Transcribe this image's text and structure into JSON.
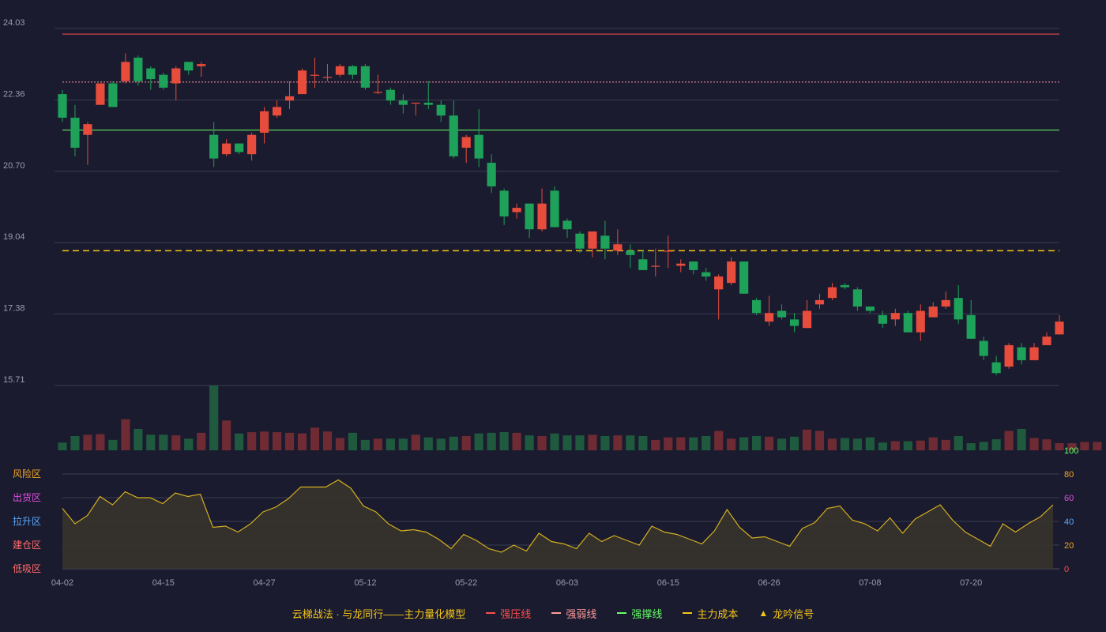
{
  "colors": {
    "background": "#1a1b2e",
    "up": "#e74c3c",
    "down": "#1ea25a",
    "grid": "#3a3c50",
    "axis_text": "#9a9cb0",
    "pressure_line": "#ff4d4d",
    "weak_line": "#ff9a9a",
    "support_line": "#66ff66",
    "cost_line": "#f5c518",
    "signal": "#f5c518",
    "osc_line": "#d4b020"
  },
  "legend": {
    "model": "云梯战法 · 与龙同行——主力量化模型",
    "pressure": "强压线",
    "weak": "强弱线",
    "support": "强撑线",
    "cost": "主力成本",
    "signal": "龙吟信号"
  },
  "chart_data": {
    "type": "candlestick",
    "y_ticks": [
      "15.71",
      "17.38",
      "19.04",
      "20.70",
      "22.36",
      "24.03"
    ],
    "ylim": [
      15.71,
      24.03
    ],
    "x_ticks": [
      "04-02",
      "04-15",
      "04-27",
      "05-12",
      "05-22",
      "06-03",
      "06-15",
      "06-26",
      "07-08",
      "07-20"
    ],
    "x_tick_index": [
      0,
      8,
      16,
      24,
      32,
      40,
      48,
      56,
      64,
      72
    ],
    "reference_lines": {
      "pressure": 23.9,
      "weak": 22.78,
      "support": 21.66,
      "cost": 18.85
    },
    "candles": [
      [
        22.5,
        21.95,
        22.6,
        21.85
      ],
      [
        21.95,
        21.25,
        22.25,
        21.05
      ],
      [
        21.55,
        21.8,
        21.85,
        20.85
      ],
      [
        22.25,
        22.75,
        22.75,
        22.25
      ],
      [
        22.75,
        22.2,
        22.8,
        22.2
      ],
      [
        22.8,
        23.25,
        23.45,
        22.75
      ],
      [
        23.35,
        22.8,
        23.4,
        22.7
      ],
      [
        23.1,
        22.85,
        23.15,
        22.6
      ],
      [
        22.95,
        22.65,
        23.0,
        22.6
      ],
      [
        22.75,
        23.1,
        23.15,
        22.35
      ],
      [
        23.25,
        23.05,
        23.25,
        22.95
      ],
      [
        23.15,
        23.2,
        23.25,
        22.9
      ],
      [
        21.55,
        21.0,
        21.85,
        20.8
      ],
      [
        21.1,
        21.35,
        21.45,
        21.05
      ],
      [
        21.35,
        21.15,
        21.35,
        21.1
      ],
      [
        21.1,
        21.55,
        21.6,
        20.95
      ],
      [
        21.6,
        22.1,
        22.2,
        21.35
      ],
      [
        22.0,
        22.2,
        22.35,
        21.95
      ],
      [
        22.35,
        22.45,
        22.8,
        22.15
      ],
      [
        22.5,
        23.05,
        23.1,
        22.5
      ],
      [
        22.95,
        22.95,
        23.35,
        22.65
      ],
      [
        22.9,
        22.9,
        23.2,
        22.8
      ],
      [
        22.95,
        23.15,
        23.2,
        22.9
      ],
      [
        23.15,
        22.95,
        23.18,
        22.85
      ],
      [
        23.15,
        22.65,
        23.2,
        22.6
      ],
      [
        22.55,
        22.55,
        22.95,
        22.5
      ],
      [
        22.6,
        22.35,
        22.65,
        22.25
      ],
      [
        22.35,
        22.25,
        22.5,
        22.05
      ],
      [
        22.3,
        22.3,
        22.3,
        22.0
      ],
      [
        22.3,
        22.25,
        22.8,
        22.15
      ],
      [
        22.25,
        22.0,
        22.35,
        21.85
      ],
      [
        22.0,
        21.05,
        22.35,
        21.0
      ],
      [
        21.25,
        21.5,
        21.55,
        20.9
      ],
      [
        21.55,
        21.0,
        22.15,
        20.8
      ],
      [
        20.9,
        20.35,
        21.1,
        20.2
      ],
      [
        20.25,
        19.65,
        20.3,
        19.45
      ],
      [
        19.75,
        19.85,
        19.95,
        19.6
      ],
      [
        19.95,
        19.35,
        19.95,
        19.15
      ],
      [
        19.35,
        19.95,
        20.3,
        19.3
      ],
      [
        20.25,
        19.4,
        20.35,
        19.4
      ],
      [
        19.55,
        19.35,
        19.6,
        19.15
      ],
      [
        19.25,
        18.9,
        19.3,
        18.8
      ],
      [
        18.9,
        19.3,
        19.3,
        18.7
      ],
      [
        19.2,
        18.9,
        19.55,
        18.65
      ],
      [
        18.85,
        19.0,
        19.35,
        18.75
      ],
      [
        18.85,
        18.75,
        19.0,
        18.45
      ],
      [
        18.65,
        18.4,
        18.85,
        18.4
      ],
      [
        18.5,
        18.5,
        18.9,
        18.25
      ],
      [
        18.85,
        18.85,
        19.2,
        18.45
      ],
      [
        18.5,
        18.55,
        18.65,
        18.35
      ],
      [
        18.6,
        18.4,
        18.6,
        18.3
      ],
      [
        18.35,
        18.25,
        18.45,
        18.15
      ],
      [
        17.95,
        18.25,
        18.3,
        17.25
      ],
      [
        18.1,
        18.6,
        18.7,
        18.05
      ],
      [
        18.6,
        17.85,
        18.6,
        17.85
      ],
      [
        17.7,
        17.4,
        17.75,
        17.35
      ],
      [
        17.2,
        17.4,
        17.8,
        17.1
      ],
      [
        17.45,
        17.3,
        17.6,
        17.25
      ],
      [
        17.25,
        17.1,
        17.4,
        16.95
      ],
      [
        17.05,
        17.45,
        17.7,
        17.05
      ],
      [
        17.6,
        17.7,
        17.85,
        17.5
      ],
      [
        17.75,
        18.0,
        18.1,
        17.7
      ],
      [
        18.05,
        18.0,
        18.1,
        17.95
      ],
      [
        17.95,
        17.55,
        18.0,
        17.45
      ],
      [
        17.55,
        17.45,
        17.55,
        17.4
      ],
      [
        17.35,
        17.15,
        17.45,
        17.05
      ],
      [
        17.25,
        17.4,
        17.5,
        17.1
      ],
      [
        17.4,
        16.95,
        17.45,
        16.95
      ],
      [
        16.95,
        17.45,
        17.6,
        16.75
      ],
      [
        17.3,
        17.55,
        17.65,
        17.3
      ],
      [
        17.55,
        17.7,
        17.9,
        17.5
      ],
      [
        17.75,
        17.25,
        18.05,
        17.15
      ],
      [
        17.35,
        16.8,
        17.7,
        16.8
      ],
      [
        16.75,
        16.4,
        16.85,
        16.3
      ],
      [
        16.25,
        16.0,
        16.4,
        15.95
      ],
      [
        16.15,
        16.65,
        16.7,
        16.1
      ],
      [
        16.6,
        16.3,
        16.7,
        16.2
      ],
      [
        16.3,
        16.6,
        16.7,
        16.3
      ],
      [
        16.65,
        16.85,
        16.95,
        16.65
      ],
      [
        16.9,
        17.2,
        17.35,
        16.9
      ]
    ],
    "volume_ymax": 100,
    "volume": [
      12,
      22,
      24,
      25,
      16,
      48,
      33,
      24,
      24,
      23,
      18,
      27,
      100,
      46,
      26,
      28,
      29,
      28,
      27,
      26,
      35,
      29,
      19,
      27,
      16,
      18,
      18,
      18,
      24,
      20,
      18,
      21,
      22,
      26,
      27,
      28,
      27,
      23,
      22,
      26,
      23,
      23,
      24,
      22,
      23,
      23,
      22,
      16,
      20,
      20,
      20,
      22,
      30,
      18,
      20,
      22,
      21,
      18,
      21,
      32,
      30,
      18,
      19,
      18,
      20,
      12,
      14,
      14,
      15,
      20,
      16,
      22,
      11,
      13,
      17,
      30,
      33,
      19,
      17,
      11,
      11,
      13,
      13
    ],
    "oscillator": {
      "bands": [
        "低吸区",
        "建仓区",
        "拉升区",
        "出货区",
        "风险区"
      ],
      "band_colors": [
        "#ff6b6b",
        "#ff6b6b",
        "#5aa8ff",
        "#e04ee0",
        "#f5a623"
      ],
      "scale": [
        "0",
        "20",
        "40",
        "60",
        "80",
        "100"
      ],
      "scale_colors": [
        "#ff4d4d",
        "#f5a623",
        "#5aa8ff",
        "#e04ee0",
        "#f5a623",
        "#66ff66"
      ],
      "values": [
        51,
        38,
        45,
        61,
        54,
        65,
        60,
        60,
        55,
        64,
        61,
        63,
        35,
        36,
        31,
        38,
        48,
        52,
        59,
        69,
        69,
        69,
        75,
        68,
        53,
        48,
        38,
        32,
        33,
        31,
        25,
        17,
        29,
        24,
        17,
        14,
        20,
        15,
        30,
        23,
        21,
        17,
        30,
        23,
        28,
        24,
        20,
        36,
        31,
        29,
        25,
        21,
        32,
        50,
        35,
        26,
        27,
        23,
        19,
        34,
        39,
        51,
        53,
        41,
        38,
        32,
        43,
        30,
        42,
        48,
        54,
        41,
        31,
        25,
        19,
        38,
        31,
        38,
        44,
        54
      ]
    }
  }
}
